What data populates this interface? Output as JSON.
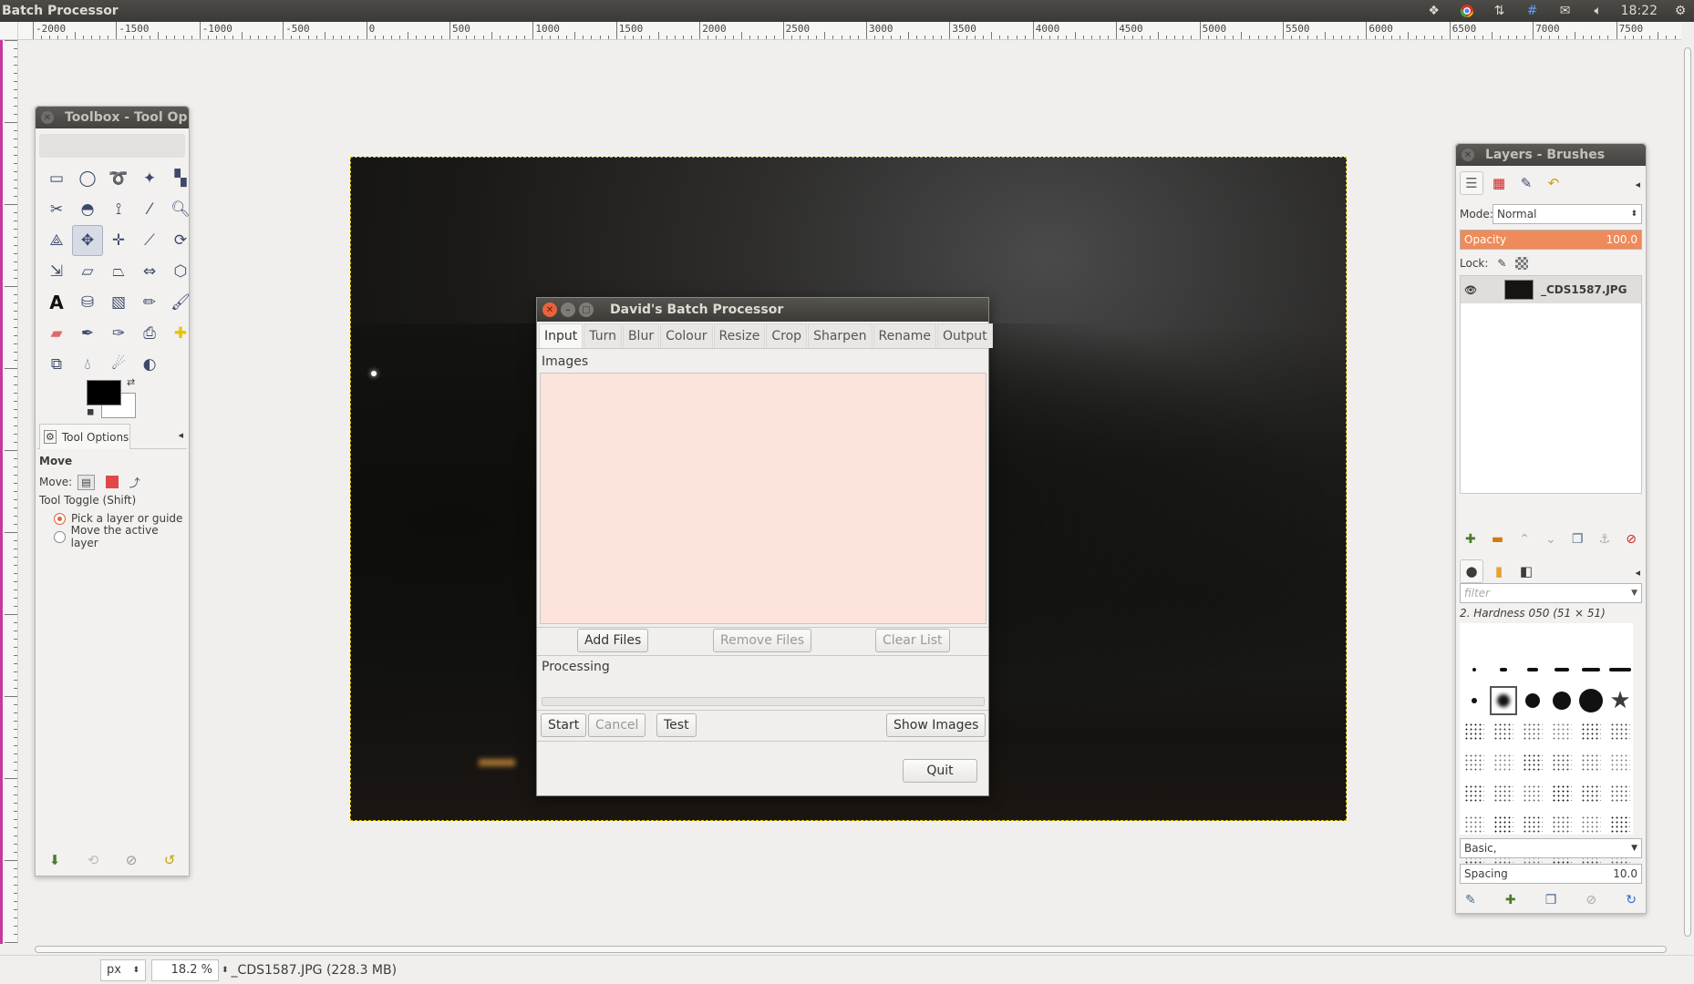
{
  "window": {
    "title": "Batch Processor"
  },
  "tray": {
    "time": "18:22",
    "icons": [
      "dropbox-icon",
      "chrome-icon",
      "network-icon",
      "keyboard-icon",
      "mail-icon",
      "volume-icon",
      "gear-icon"
    ]
  },
  "ruler": {
    "h_labels": [
      "-2000",
      "-1500",
      "-1000",
      "-500",
      "0",
      "500",
      "1000",
      "1500",
      "2000",
      "2500",
      "3000",
      "3500",
      "4000",
      "4500",
      "5000",
      "5500",
      "6000",
      "6500",
      "7000",
      "7500"
    ]
  },
  "toolbox": {
    "title": "Toolbox - Tool Op",
    "tab_label": "Tool Options",
    "tool_name": "Move",
    "move_label": "Move:",
    "toggle_label": "Tool Toggle  (Shift)",
    "option1": "Pick a layer or guide",
    "option2": "Move the active layer"
  },
  "dialog": {
    "title": "David's Batch Processor",
    "tabs": [
      "Input",
      "Turn",
      "Blur",
      "Colour",
      "Resize",
      "Crop",
      "Sharpen",
      "Rename",
      "Output"
    ],
    "images_label": "Images",
    "add_files": "Add Files",
    "remove_files": "Remove Files",
    "clear_list": "Clear List",
    "processing_label": "Processing",
    "start": "Start",
    "cancel": "Cancel",
    "test": "Test",
    "show_images": "Show Images",
    "quit": "Quit",
    "list_color": "#fce3dc"
  },
  "layers": {
    "title": "Layers - Brushes",
    "mode_label": "Mode:",
    "mode_value": "Normal",
    "opacity_label": "Opacity",
    "opacity_value": "100.0",
    "lock_label": "Lock:",
    "layer_name": "_CDS1587.JPG",
    "filter_placeholder": "filter",
    "brush_name": "2. Hardness 050 (51 × 51)",
    "brush_set": "Basic,",
    "spacing_label": "Spacing",
    "spacing_value": "10.0"
  },
  "status": {
    "unit": "px",
    "zoom": "18.2 %",
    "file_info": "_CDS1587.JPG (228.3 MB)"
  }
}
